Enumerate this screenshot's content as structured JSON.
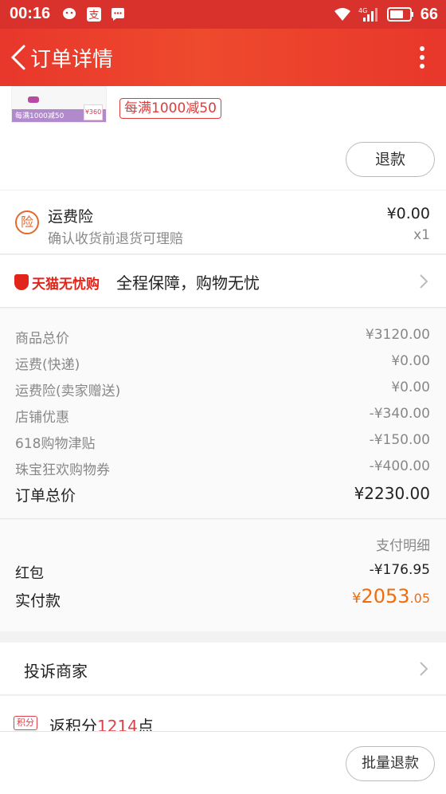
{
  "status_bar": {
    "time": "00:16",
    "network": "4G",
    "battery": "66"
  },
  "header": {
    "title": "订单详情",
    "back_icon": "chevron-left-icon",
    "more_icon": "more-vertical-icon"
  },
  "product": {
    "thumbnail_promo_text": "每满1000减50",
    "thumbnail_price_tag": "¥360",
    "promo_badge": "每满1000减50",
    "refund_button": "退款"
  },
  "insurance": {
    "icon_char": "险",
    "name": "运费险",
    "description": "确认收货前退货可理赔",
    "price": "¥0.00",
    "quantity": "x1"
  },
  "guarantee": {
    "brand": "天猫无忧购",
    "text": "全程保障，购物无忧"
  },
  "breakdown": {
    "rows": [
      {
        "label": "商品总价",
        "value": "¥3120.00"
      },
      {
        "label": "运费(快递)",
        "value": "¥0.00"
      },
      {
        "label": "运费险(卖家赠送)",
        "value": "¥0.00"
      },
      {
        "label": "店铺优惠",
        "value": "-¥340.00"
      },
      {
        "label": "618购物津贴",
        "value": "-¥150.00"
      },
      {
        "label": "珠宝狂欢购物券",
        "value": "-¥400.00"
      }
    ],
    "total_label": "订单总价",
    "total_value": "¥2230.00"
  },
  "payment": {
    "detail_label": "支付明细",
    "red_packet_label": "红包",
    "red_packet_value": "-¥176.95",
    "actual_label": "实付款",
    "actual_currency": "¥",
    "actual_int": "2053",
    "actual_dec": ".05"
  },
  "links": {
    "complain": "投诉商家",
    "points_badge": "积分",
    "points_prefix": "返积分",
    "points_value": "1214",
    "points_suffix": "点"
  },
  "actions": {
    "batch_refund": "批量退款"
  },
  "colors": {
    "header_red": "#e8372c",
    "accent_orange": "#f26c0d",
    "tmall_red": "#e1251b"
  }
}
